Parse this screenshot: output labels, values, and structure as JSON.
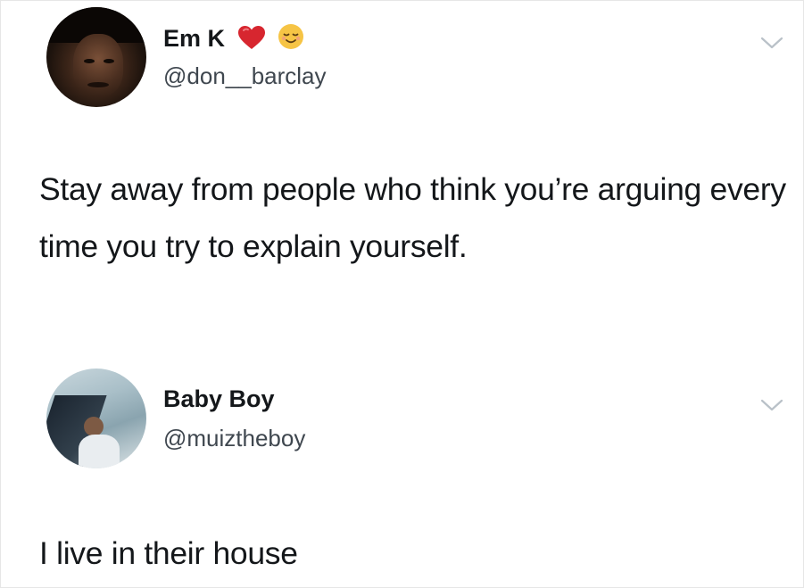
{
  "tweets": [
    {
      "display_name": "Em K",
      "handle": "@don__barclay",
      "name_emojis": [
        "red-heart",
        "relieved-face"
      ],
      "text": "Stay away from people who think you’re arguing every time you try to explain yourself."
    },
    {
      "display_name": "Baby Boy",
      "handle": "@muiztheboy",
      "text": "I live in their house"
    }
  ],
  "colors": {
    "text": "#14171a",
    "handle": "#3f474f",
    "chevron": "#b9c1c8",
    "heart": "#d7262f",
    "emoji_face": "#f6c445"
  }
}
